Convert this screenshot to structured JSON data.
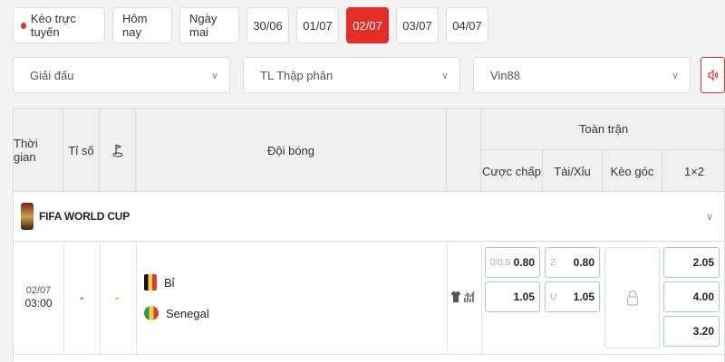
{
  "tabs": [
    {
      "label": "Kèo trực tuyến",
      "live": true
    },
    {
      "label": "Hôm nay"
    },
    {
      "label": "Ngày mai"
    },
    {
      "label": "30/06"
    },
    {
      "label": "01/07"
    },
    {
      "label": "02/07",
      "active": true
    },
    {
      "label": "03/07"
    },
    {
      "label": "04/07"
    }
  ],
  "filters": {
    "league": "Giải đấu",
    "odds_format": "TL Thập phân",
    "bookmaker": "Vin88"
  },
  "header": {
    "time": "Thời gian",
    "score": "Tỉ số",
    "teams": "Đội bóng",
    "full_match": "Toàn trận",
    "handicap": "Cược chấp",
    "over_under": "Tài/Xỉu",
    "corner": "Kèo góc",
    "x12": "1×2"
  },
  "league": {
    "name": "FIFA WORLD CUP"
  },
  "match": {
    "date": "02/07",
    "time": "03:00",
    "score": "-",
    "status": "-",
    "home": "Bỉ",
    "away": "Senegal",
    "handicap": {
      "home_line": "0/0.5",
      "home_odds": "0.80",
      "away_odds": "1.05"
    },
    "over_under": {
      "over_line": "2",
      "over_odds": "0.80",
      "under_label": "U",
      "under_odds": "1.05"
    },
    "x12": {
      "home": "2.05",
      "draw": "4.00",
      "away": "3.20"
    }
  },
  "colors": {
    "accent": "#e52d27",
    "odds_border": "#9fd4b0"
  }
}
